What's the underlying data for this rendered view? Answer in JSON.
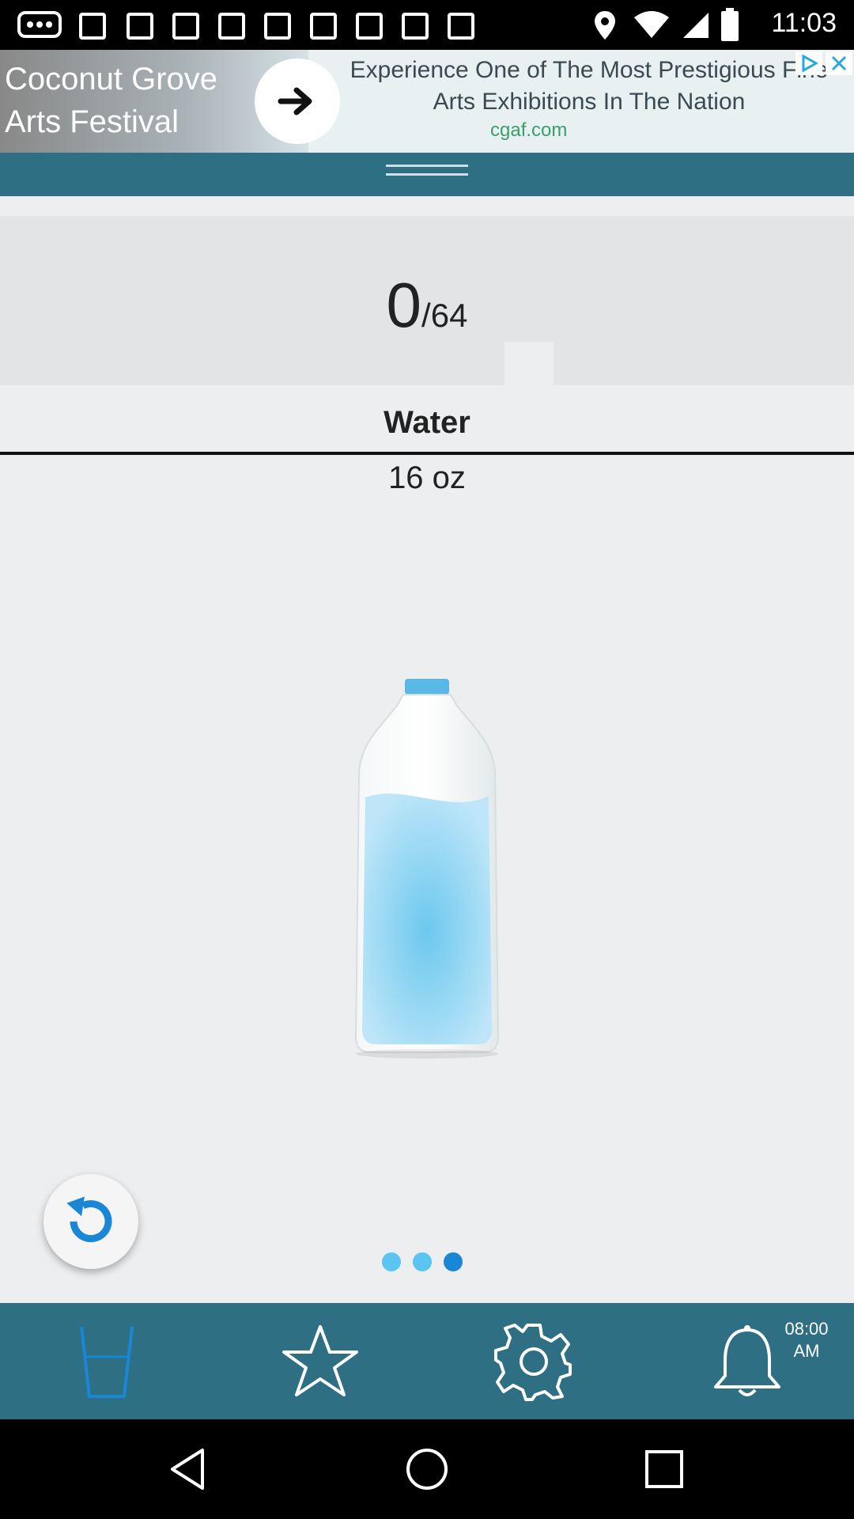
{
  "status_bar": {
    "time": "11:03",
    "icons": [
      "more-icon",
      "notification-icon",
      "notification-icon",
      "notification-icon",
      "notification-icon",
      "notification-icon",
      "notification-icon",
      "notification-icon",
      "notification-icon",
      "location-icon",
      "wifi-icon",
      "signal-icon",
      "battery-icon"
    ]
  },
  "ad": {
    "title": "Coconut Grove Arts Festival",
    "headline": "Experience One of The Most Prestigious Fine Arts Exhibitions In The Nation",
    "url": "cgaf.com"
  },
  "tracker": {
    "consumed": "0",
    "goal": "/64"
  },
  "drink": {
    "name": "Water",
    "size": "16 oz"
  },
  "pager": {
    "pages": 3,
    "active_index": 2
  },
  "bottom_nav": {
    "items": [
      {
        "name": "glass-icon",
        "active": true
      },
      {
        "name": "star-icon",
        "active": false
      },
      {
        "name": "gear-icon",
        "active": false
      },
      {
        "name": "bell-icon",
        "active": false
      }
    ],
    "alarm_time_line1": "08:00",
    "alarm_time_line2": "AM"
  },
  "colors": {
    "teal": "#2f6f84",
    "accent_blue": "#1a86d6",
    "dot_light": "#5cc4f0",
    "background": "#eceeef"
  }
}
